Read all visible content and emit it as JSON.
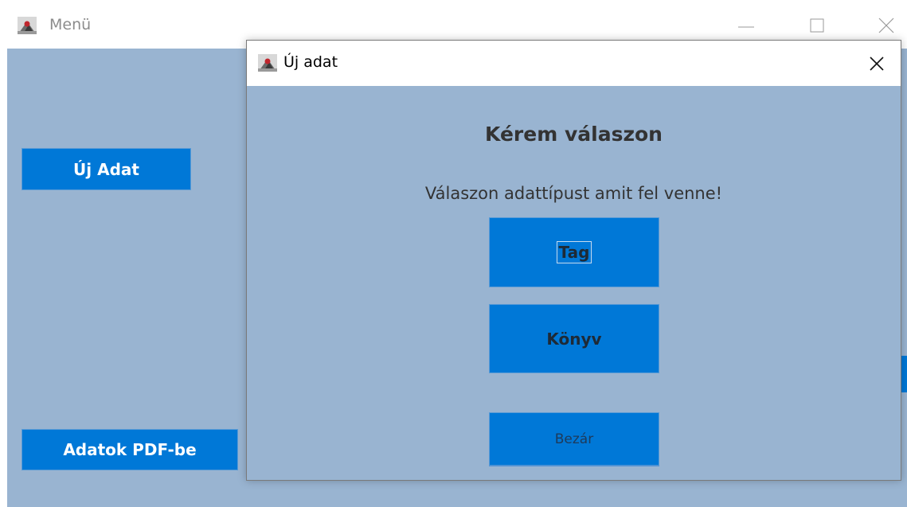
{
  "main_window": {
    "title": "Menü",
    "buttons": {
      "new_data": "Új Adat",
      "export_pdf": "Adatok PDF-be"
    }
  },
  "dialog": {
    "title": "Új adat",
    "heading": "Kérem válaszon",
    "prompt": "Válaszon adattípust amit fel venne!",
    "buttons": {
      "member": "Tag",
      "book": "Könyv",
      "close": "Bezár"
    }
  },
  "icons": {
    "app": "java-app-icon",
    "minimize": "minimize-icon",
    "maximize": "maximize-icon",
    "close": "close-icon"
  },
  "colors": {
    "panel": "#99b4d1",
    "button": "#0078d7"
  }
}
